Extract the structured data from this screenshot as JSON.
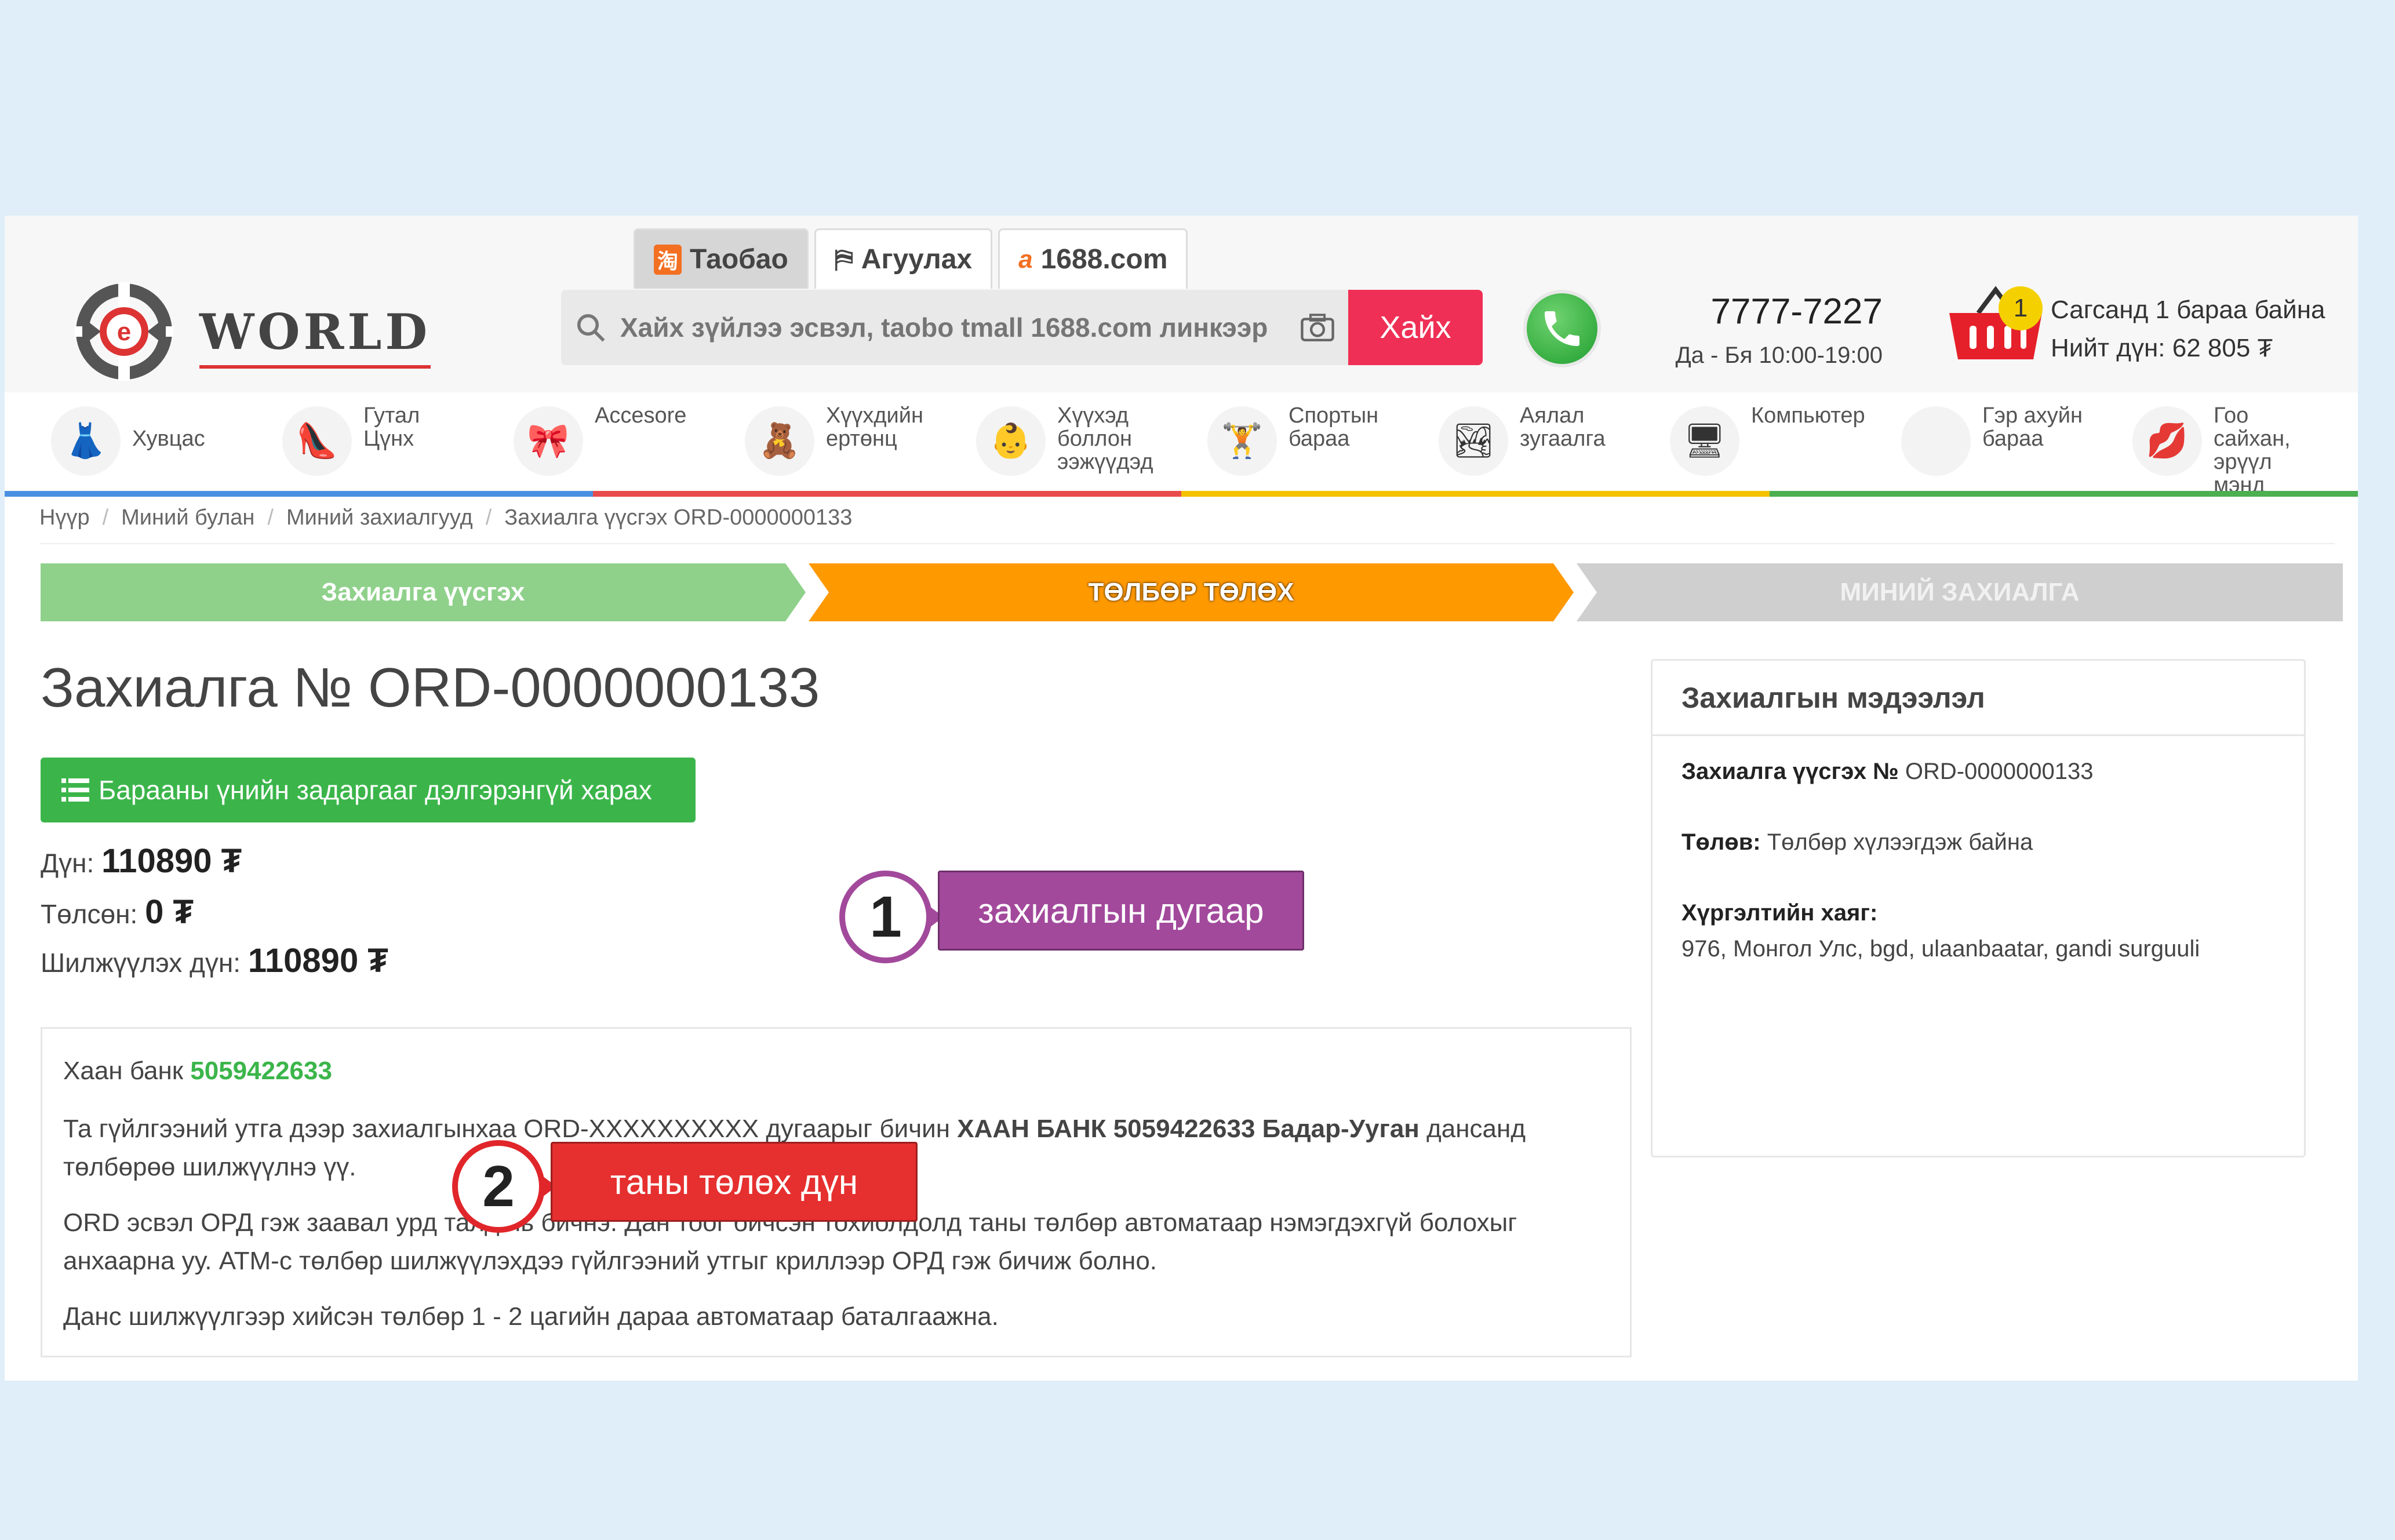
{
  "header": {
    "logo_text": "WORLD",
    "tabs": [
      {
        "label": "Таобао",
        "icon": "taobao-icon"
      },
      {
        "label": "Агуулах",
        "icon": "cart-flag-icon"
      },
      {
        "label": "1688.com",
        "icon": "alibaba-icon"
      }
    ],
    "search": {
      "placeholder": "Хайх зүйлээ эсвэл, taobo tmall 1688.com линкээр",
      "button": "Хайх"
    },
    "phone": {
      "number": "7777-7227",
      "hours": "Да - Бя 10:00-19:00"
    },
    "cart": {
      "count": "1",
      "line1": "Сагсанд 1 бараа байна",
      "line2": "Нийт дүн: 62 805 ₮"
    }
  },
  "categories": [
    {
      "label": "Хувцас",
      "icon": "clothes-icon"
    },
    {
      "label": "Гутал Цүнх",
      "icon": "shoe-icon"
    },
    {
      "label": "Accesore",
      "icon": "bowtie-icon"
    },
    {
      "label": "Хүүхдийн\nертөнц",
      "icon": "teddy-icon"
    },
    {
      "label": "Хүүхэд\nболлон\nээжүүдэд",
      "icon": "baby-icon"
    },
    {
      "label": "Спортын\nбараа",
      "icon": "dumbbell-icon"
    },
    {
      "label": "Аялал\nзугаалга",
      "icon": "travel-icon"
    },
    {
      "label": "Компьютер",
      "icon": "computer-icon"
    },
    {
      "label": "Гэр ахуйн\nбараа",
      "icon": "home-icon"
    },
    {
      "label": "Гоо сайхан,\nэрүүл мэнд",
      "icon": "lips-icon"
    }
  ],
  "category_colors": [
    "#4a90e2",
    "#e94c4c",
    "#f5c200",
    "#4caf50"
  ],
  "breadcrumb": [
    "Нүүр",
    "Миний булан",
    "Миний захиалгууд",
    "Захиалга үүсгэх ORD-0000000133"
  ],
  "steps": [
    "Захиалга үүсгэх",
    "ТӨЛБӨР ТӨЛӨХ",
    "МИНИЙ ЗАХИАЛГА"
  ],
  "order": {
    "title": "Захиалга № ORD-0000000133",
    "details_button": "Барааны үнийн задаргааг дэлгэрэнгүй харах",
    "amount_label": "Дүн:",
    "amount_value": "110890 ₮",
    "paid_label": "Төлсөн:",
    "paid_value": "0 ₮",
    "transfer_label": "Шилжүүлэх дүн:",
    "transfer_value": "110890 ₮"
  },
  "bank": {
    "name": "Хаан банк",
    "account": "5059422633",
    "p1_pre": "Та гүйлгээний утга дээр захиалгынхаа ORD-XXXXXXXXXX дугаарыг бичин ",
    "p1_bold": "ХААН БАНК 5059422633 Бадар-Уугaн",
    "p1_post": " дансанд төлбөрөө шилжүүлнэ үү.",
    "p2": "ORD эсвэл ОРД гэж заавал урд талд нь бичнэ. Дан тоог бичсэн тохиолдолд таны төлбөр автоматаар нэмэгдэхгүй болохыг анхаарна уу. АТМ-с төлбөр шилжүүлэхдээ гүйлгээний утгыг криллээр ОРД гэж бичиж болно.",
    "p3": "Данс шилжүүлгээр хийсэн төлбөр 1 - 2 цагийн дараа автоматаар баталгаажна."
  },
  "info_panel": {
    "title": "Захиалгын мэдээлэл",
    "order_label": "Захиалга үүсгэх №",
    "order_value": " ORD-0000000133",
    "status_label": "Төлөв:",
    "status_value": " Төлбөр хүлээгдэж байна",
    "address_label": "Хүргэлтийн хаяг:",
    "address_value": "976, Монгол Улс, bgd, ulaanbaatar, gandi surguuli"
  },
  "callouts": [
    {
      "number": "1",
      "text": "захиалгын дугаар",
      "color": "#a2499c"
    },
    {
      "number": "2",
      "text": "таны төлөх дүн",
      "color": "#e62f2f"
    }
  ]
}
